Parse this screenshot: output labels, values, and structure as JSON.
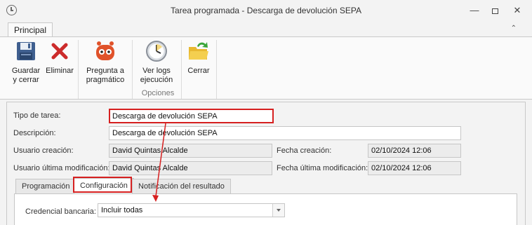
{
  "window": {
    "title": "Tarea programada - Descarga de devolución SEPA"
  },
  "ribbon": {
    "tab_label": "Principal",
    "buttons": {
      "save": {
        "line1": "Guardar",
        "line2": "y cerrar"
      },
      "delete": {
        "line1": "Eliminar"
      },
      "ask": {
        "line1": "Pregunta a",
        "line2": "pragmático"
      },
      "logs": {
        "line1": "Ver logs",
        "line2": "ejecución"
      },
      "close": {
        "line1": "Cerrar"
      }
    },
    "group_label": "Opciones"
  },
  "form": {
    "task_type": {
      "label": "Tipo de tarea:",
      "value": "Descarga de devolución SEPA"
    },
    "description": {
      "label": "Descripción:",
      "value": "Descarga de devolución SEPA"
    },
    "creation_user": {
      "label": "Usuario creación:",
      "value": "David Quintas Alcalde"
    },
    "creation_date": {
      "label": "Fecha creación:",
      "value": "02/10/2024 12:06"
    },
    "modified_user": {
      "label": "Usuario última modificación:",
      "value": "David Quintas Alcalde"
    },
    "modified_date": {
      "label": "Fecha última modificación:",
      "value": "02/10/2024 12:06"
    }
  },
  "tabs": [
    {
      "label": "Programación"
    },
    {
      "label": "Configuración"
    },
    {
      "label": "Notificación del resultado"
    }
  ],
  "config": {
    "credential_label": "Credencial bancaria:",
    "credential_value": "Incluir todas"
  },
  "colors": {
    "highlight": "#d62020"
  }
}
